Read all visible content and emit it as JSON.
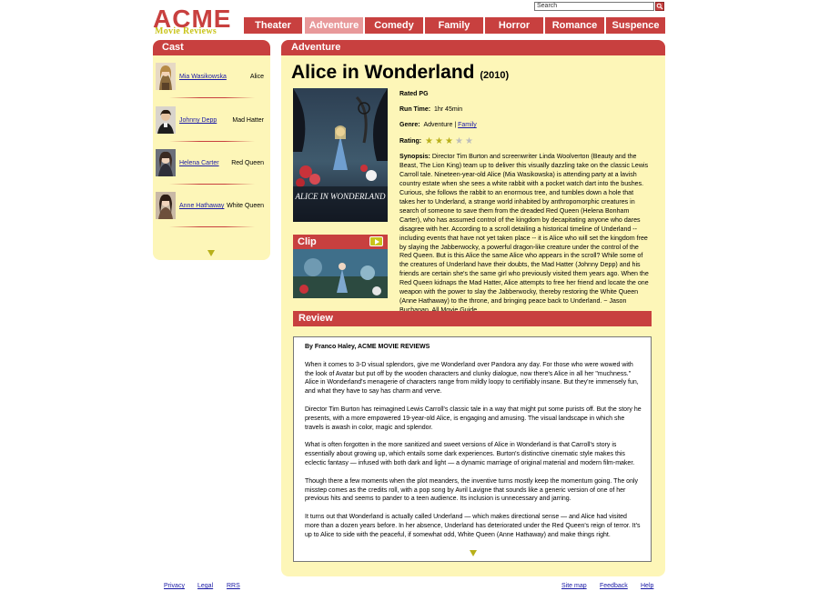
{
  "logo": {
    "main": "ACME",
    "sub": "Movie Reviews"
  },
  "search": {
    "placeholder": "Search"
  },
  "nav": [
    "Theater",
    "Adventure",
    "Comedy",
    "Family",
    "Horror",
    "Romance",
    "Suspence"
  ],
  "nav_active": "Adventure",
  "cast": {
    "title": "Cast",
    "members": [
      {
        "name": "Mia Wasikowska",
        "role": "Alice"
      },
      {
        "name": "Johnny Depp",
        "role": "Mad Hatter"
      },
      {
        "name": "Helena Carter",
        "role": "Red Queen"
      },
      {
        "name": "Anne Hathaway",
        "role": "White Queen"
      }
    ]
  },
  "main": {
    "section": "Adventure",
    "title": "Alice in Wonderland",
    "year": "(2010)",
    "poster_text": "ALICE IN WONDERLAND",
    "rated_label": "Rated",
    "rated": "PG",
    "runtime_label": "Run Time:",
    "runtime": "1hr 45min",
    "genre_label": "Genre:",
    "genre_primary": "Adventure",
    "genre_sep": "|",
    "genre_secondary": "Family",
    "rating_label": "Rating:",
    "rating_stars": 3,
    "rating_max": 5,
    "synopsis_label": "Synopsis:",
    "synopsis": "Director Tim Burton and screenwriter Linda Woolverton (Beauty and the Beast, The Lion King) team up to deliver this visually dazzling take on the classic Lewis Carroll tale. Nineteen-year-old Alice (Mia Wasikowska) is attending party at a lavish country estate when she sees a white rabbit with a pocket watch dart into the bushes. Curious, she follows the rabbit to an enormous tree, and tumbles down a hole that takes her to Underland, a strange world inhabited by anthropomorphic creatures in search of someone to save them from the dreaded Red Queen (Helena Bonham Carter), who has assumed control of the kingdom by decapitating anyone who dares disagree with her. According to a scroll detailing a historical timeline of Underland -- including events that have not yet taken place -- it is Alice who will set the kingdom free by slaying the Jabberwocky, a powerful dragon-like creature under the control of the Red Queen. But is this Alice the same Alice who appears in the scroll? While some of the creatures of Underland have their doubts, the Mad Hatter (Johnny Depp) and his friends are certain she's the same girl who previously visited them years ago. When the Red Queen kidnaps the Mad Hatter, Alice attempts to free her friend and locate the one weapon with the power to slay the Jabberwocky, thereby restoring the White Queen (Anne Hathaway) to the throne, and bringing peace back to Underland. ~ Jason Buchanan, All Movie Guide",
    "clip_label": "Clip"
  },
  "review": {
    "title": "Review",
    "byline": "By Franco Haley, ACME MOVIE REVIEWS",
    "paragraphs": [
      "When it comes to 3-D visual splendors, give me Wonderland over Pandora any day. For those who were wowed with the look of Avatar but put off by the wooden characters and clunky dialogue, now there's Alice in all her \"muchness.\" Alice in Wonderland's menagerie of characters range from mildly loopy to certifiably insane. But they're immensely fun, and what they have to say has charm and verve.",
      "Director Tim Burton has reimagined Lewis Carroll's classic tale in a way that might put some purists off. But the story he presents, with a more empowered 19-year-old Alice, is engaging and amusing. The visual landscape in which she travels is awash in color, magic and splendor.",
      "What is often forgotten in the more sanitized and sweet versions of Alice in Wonderland is that Carroll's story is essentially about growing up, which entails some dark experiences. Burton's distinctive cinematic style makes this eclectic fantasy — infused with both dark and light — a dynamic marriage of original material and modern film-maker.",
      "Though there a few moments when the plot meanders, the inventive turns mostly keep the momentum going. The only misstep comes as the credits roll, with a pop song by Avril Lavigne that sounds like a generic version of one of her previous hits and seems to pander to a teen audience. Its inclusion is unnecessary and jarring.",
      "It turns out that Wonderland is actually called Underland — which makes directional sense — and Alice had visited more than a dozen years before. In her absence, Underland has deteriorated under the Red Queen's reign of terror. It's up to Alice to side with the peaceful, if somewhat odd, White Queen (Anne Hathaway) and make things right."
    ]
  },
  "footer": {
    "left": [
      "Privacy",
      "Legal",
      "RRS"
    ],
    "right": [
      "Site map",
      "Feedback",
      "Help"
    ]
  },
  "colors": {
    "accent": "#c8403f",
    "accent_light": "#e8999a",
    "panel": "#fdf6b8",
    "olive": "#c9c41a",
    "link": "#1a1aa6"
  }
}
